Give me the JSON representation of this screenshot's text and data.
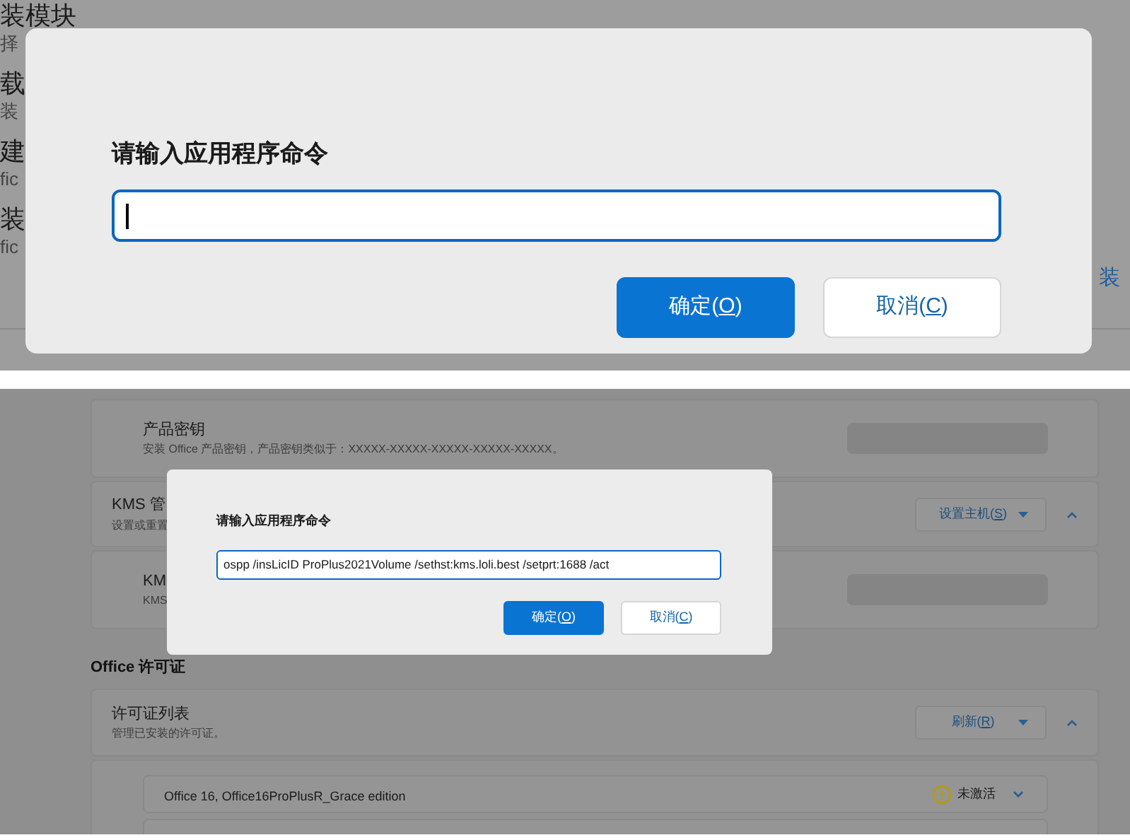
{
  "top_view": {
    "background_texts": [
      {
        "text": "装模块",
        "kind": "title"
      },
      {
        "text": "择",
        "kind": "description"
      },
      {
        "text": "载",
        "kind": "title"
      },
      {
        "text": "装",
        "kind": "description"
      },
      {
        "text": "建",
        "kind": "title"
      },
      {
        "text": "fic",
        "kind": "description"
      },
      {
        "text": "装",
        "kind": "title"
      },
      {
        "text": "fic",
        "kind": "description"
      }
    ],
    "side_link": "装",
    "dialog": {
      "title": "请输入应用程序命令",
      "input": {
        "focused": true
      },
      "buttons": [
        {
          "text": "确定(",
          "mnemonic": "O",
          "end": ")",
          "primary": true
        },
        {
          "text": "取消(",
          "mnemonic": "C",
          "end": ")",
          "primary": false
        }
      ]
    }
  },
  "bottom_view": {
    "settings": [
      {
        "kind": "key",
        "title": "产品密钥",
        "description": "安装 Office 产品密钥，产品密钥类似于：XXXXX-XXXXX-XXXXX-XXXXX-XXXXX。"
      },
      {
        "kind": "group",
        "title": "KMS 管",
        "description": "设置或重置",
        "button": {
          "text": "设置主机(",
          "mnemonic": "S",
          "end": ")"
        },
        "expanded": true
      },
      {
        "kind": "key",
        "title": "KM",
        "description": "KMS"
      }
    ],
    "section_title": "Office 许可证",
    "license_group": {
      "title": "许可证列表",
      "description": "管理已安装的许可证。",
      "button": {
        "text": "刷新(",
        "mnemonic": "R",
        "end": ")"
      },
      "expanded": true,
      "licenses": [
        {
          "name": "Office 16, Office16ProPlusR_Grace edition",
          "status": "未激活",
          "activated": false,
          "expanded": false
        }
      ]
    },
    "dialog": {
      "title": "请输入应用程序命令",
      "input": {
        "value": "ospp /insLicID ProPlus2021Volume /sethst:kms.loli.best /setprt:1688 /act",
        "focused": true
      },
      "buttons": [
        {
          "text": "确定(",
          "mnemonic": "O",
          "end": ")",
          "primary": true
        },
        {
          "text": "取消(",
          "mnemonic": "C",
          "end": ")",
          "primary": false
        }
      ]
    }
  }
}
